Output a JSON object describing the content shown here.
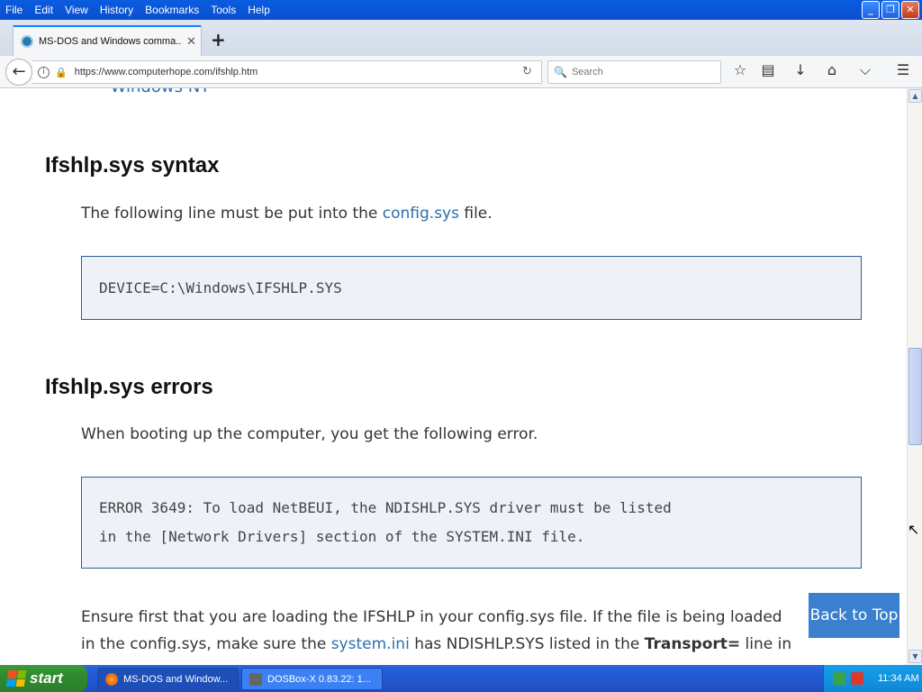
{
  "menu": [
    "File",
    "Edit",
    "View",
    "History",
    "Bookmarks",
    "Tools",
    "Help"
  ],
  "window_buttons": {
    "minimize": "_",
    "maximize": "❐",
    "close": "✕"
  },
  "tab": {
    "title": "MS-DOS and Windows comma...",
    "close": "✕",
    "new_tab": "+"
  },
  "navbar": {
    "url": "https://www.computerhope.com/ifshlp.htm",
    "search_placeholder": "Search"
  },
  "content": {
    "bullet_link": "Windows NT",
    "section1": {
      "heading": "Ifshlp.sys syntax",
      "para_prefix": "The following line must be put into the ",
      "para_link": "config.sys",
      "para_suffix": " file.",
      "code": "DEVICE=C:\\Windows\\IFSHLP.SYS"
    },
    "section2": {
      "heading": "Ifshlp.sys errors",
      "para": "When booting up the computer, you get the following error.",
      "code_line1": "ERROR 3649: To load NetBEUI, the NDISHLP.SYS driver must be listed",
      "code_line2": "in the [Network Drivers] section of the SYSTEM.INI file.",
      "para2_line1": "Ensure first that you are loading the IFSHLP in your config.sys file. If the file is being loaded",
      "para2_line2_prefix": "in the config.sys, make sure the ",
      "para2_line2_link": "system.ini",
      "para2_line2_mid": " has NDISHLP.SYS listed in the ",
      "para2_line2_bold": "Transport=",
      "para2_line2_suffix": " line in"
    },
    "back_to_top": "Back to Top"
  },
  "taskbar": {
    "start": "start",
    "items": [
      "MS-DOS and Window...",
      "DOSBox-X 0.83.22: 1..."
    ],
    "clock": "11:34 AM"
  },
  "colors": {
    "link": "#2c6fad",
    "code_bg": "#eef2f8",
    "code_border": "#2d5e91",
    "back_to_top": "#3a80cf"
  }
}
